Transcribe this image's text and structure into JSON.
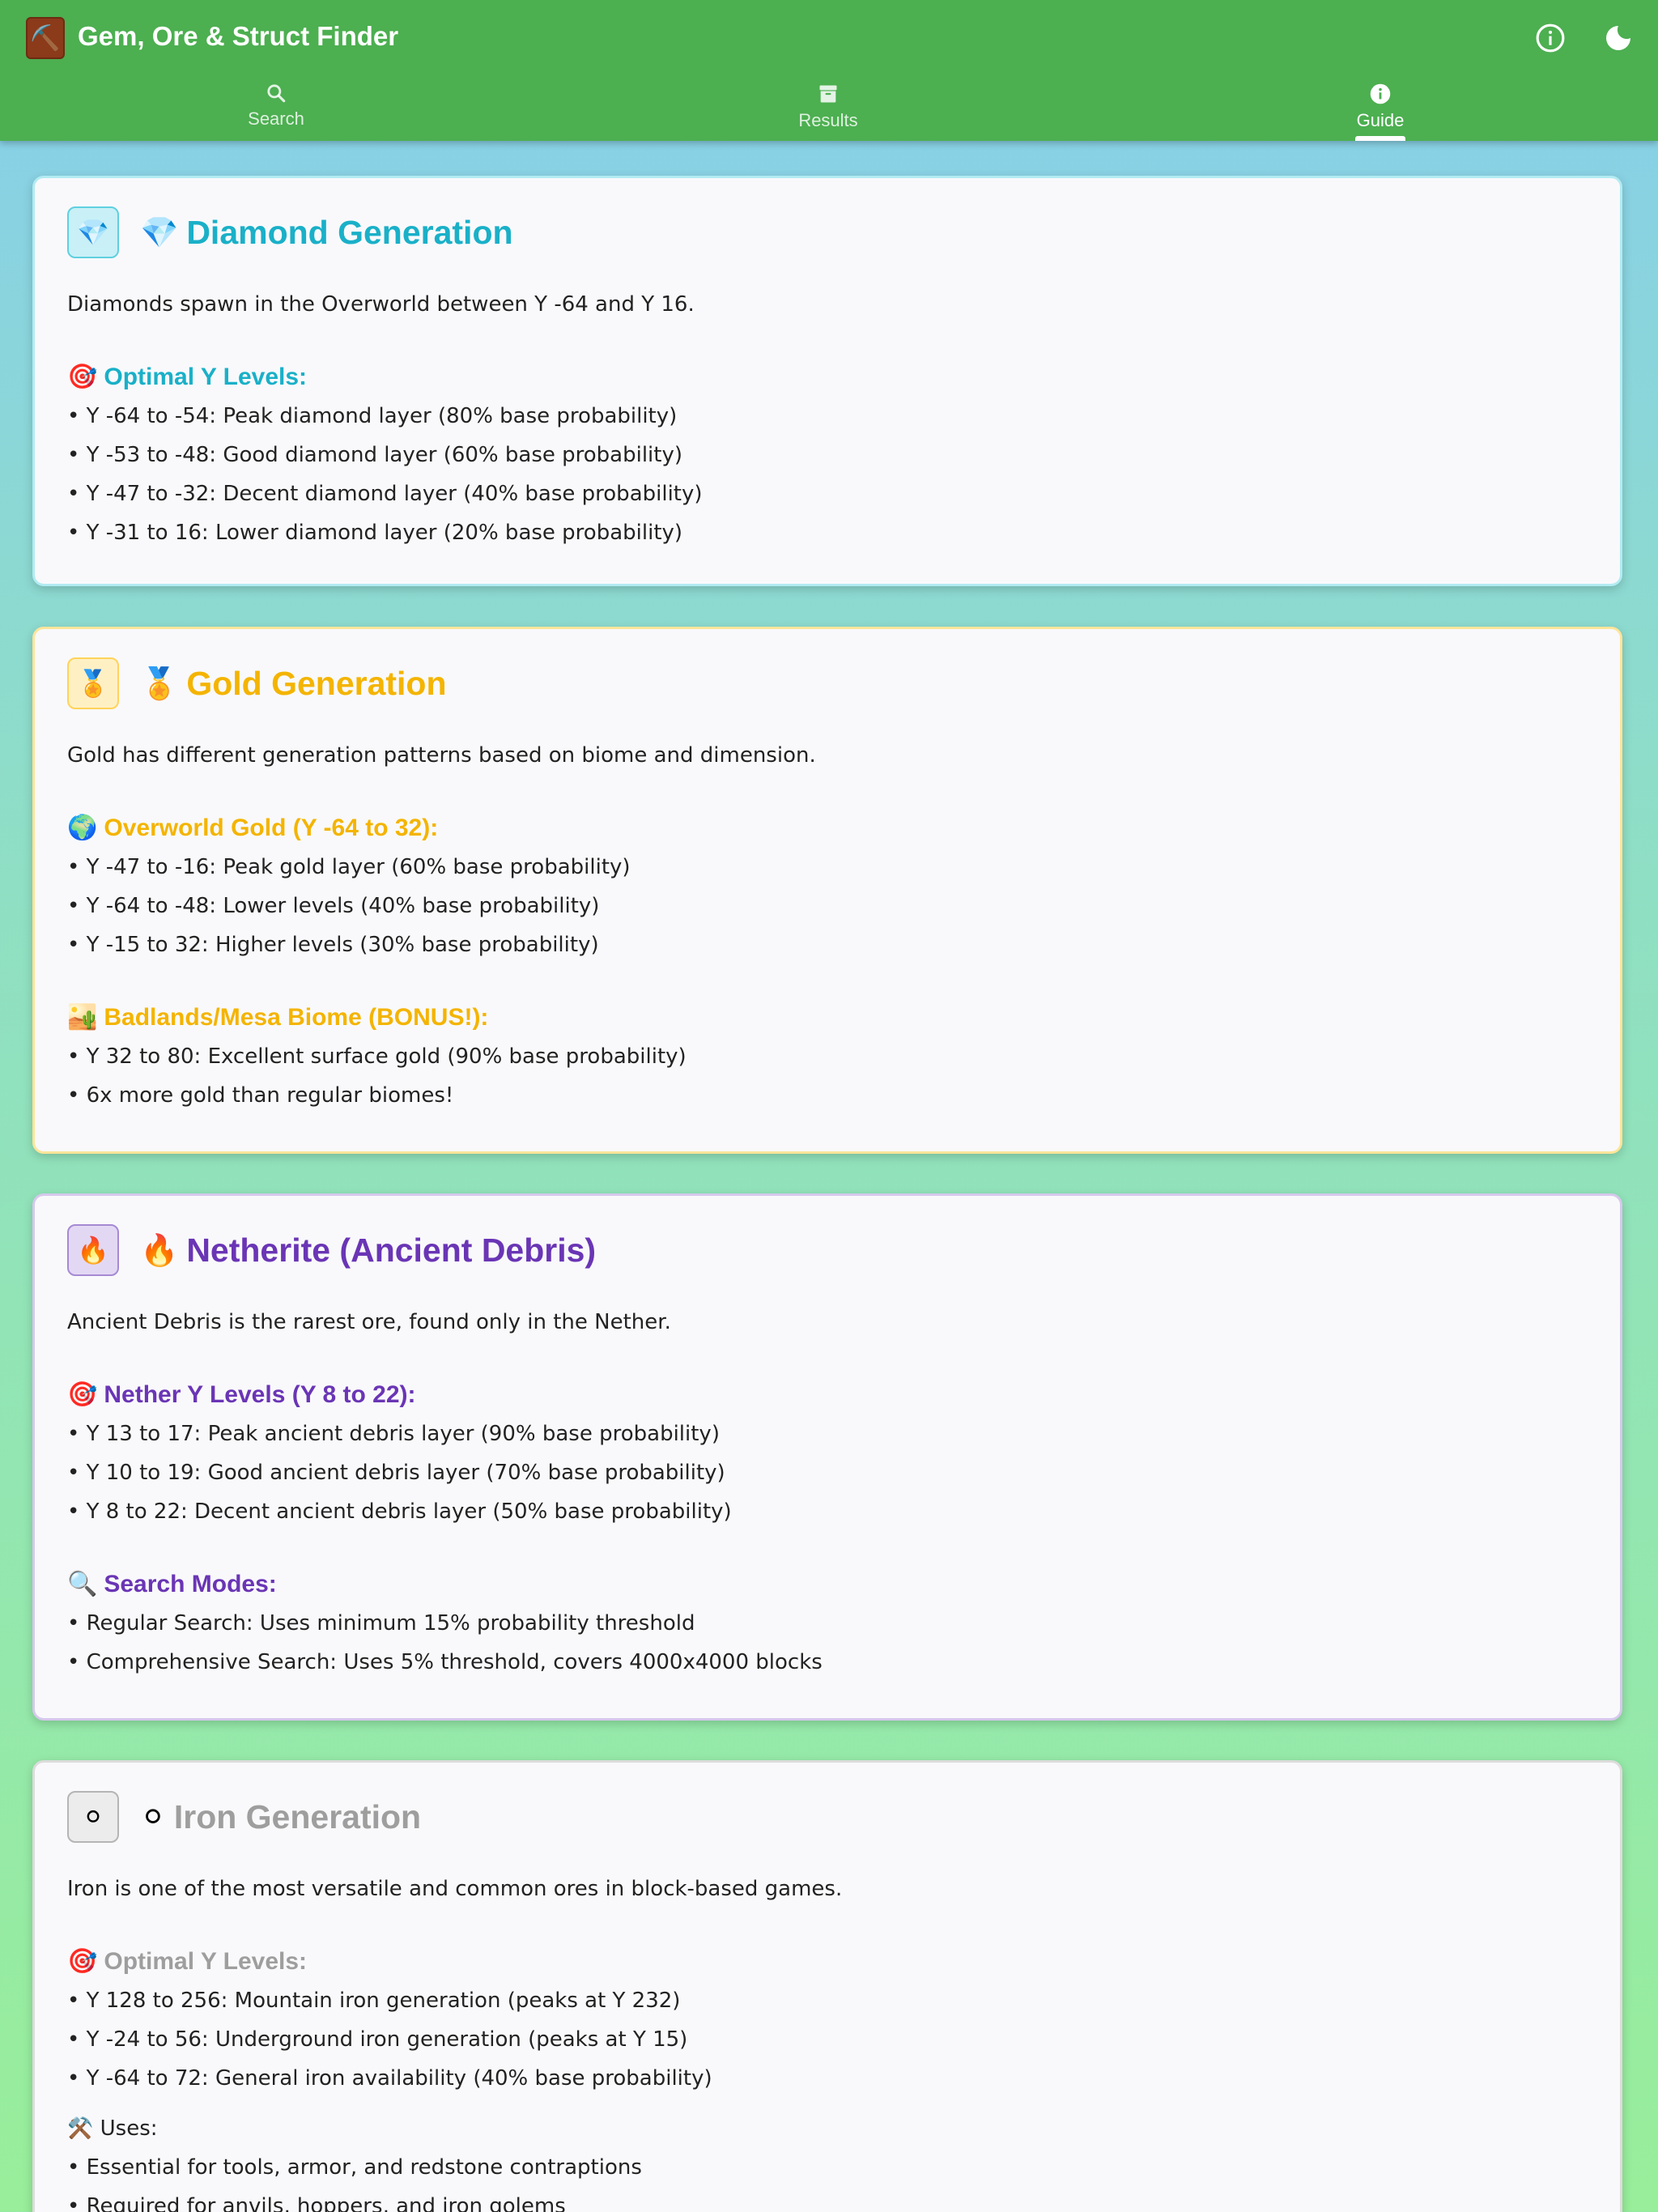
{
  "app": {
    "title": "Gem, Ore & Struct Finder",
    "logo_icon": "⛏️",
    "colors": {
      "appbar": "#4caf50"
    }
  },
  "header_actions": [
    {
      "name": "info-icon"
    },
    {
      "name": "dark-mode-icon"
    }
  ],
  "tabs": [
    {
      "label": "Search",
      "icon": "search-icon",
      "active": false
    },
    {
      "label": "Results",
      "icon": "archive-icon",
      "active": false
    },
    {
      "label": "Guide",
      "icon": "info-icon",
      "active": true
    }
  ],
  "cards": [
    {
      "id": "diamond",
      "badge": "💎",
      "emoji": "💎",
      "title": "Diamond Generation",
      "accent": "#1ab0c8",
      "description": "Diamonds spawn in the Overworld between Y -64 and Y 16.",
      "sections": [
        {
          "emoji": "🎯",
          "heading": "Optimal Y Levels:",
          "items": [
            "• Y -64 to -54: Peak diamond layer (80% base probability)",
            "• Y -53 to -48: Good diamond layer (60% base probability)",
            "• Y -47 to -32: Decent diamond layer (40% base probability)",
            "• Y -31 to 16: Lower diamond layer (20% base probability)"
          ]
        }
      ]
    },
    {
      "id": "gold",
      "badge": "🏅",
      "emoji": "🏅",
      "title": "Gold Generation",
      "accent": "#f4b400",
      "description": "Gold has different generation patterns based on biome and dimension.",
      "sections": [
        {
          "emoji": "🌍",
          "heading": "Overworld Gold (Y -64 to 32):",
          "items": [
            "• Y -47 to -16: Peak gold layer (60% base probability)",
            "• Y -64 to -48: Lower levels (40% base probability)",
            "• Y -15 to 32: Higher levels (30% base probability)"
          ]
        },
        {
          "emoji": "🏜️",
          "heading": "Badlands/Mesa Biome (BONUS!):",
          "items": [
            "• Y 32 to 80: Excellent surface gold (90% base probability)",
            "• 6x more gold than regular biomes!"
          ]
        }
      ]
    },
    {
      "id": "netherite",
      "badge": "🔥",
      "emoji": "🔥",
      "title": "Netherite (Ancient Debris)",
      "accent": "#6a35b5",
      "description": "Ancient Debris is the rarest ore, found only in the Nether.",
      "sections": [
        {
          "emoji": "🎯",
          "heading": "Nether Y Levels (Y 8 to 22):",
          "items": [
            "• Y 13 to 17: Peak ancient debris layer (90% base probability)",
            "• Y 10 to 19: Good ancient debris layer (70% base probability)",
            "• Y 8 to 22: Decent ancient debris layer (50% base probability)"
          ]
        },
        {
          "emoji": "🔍",
          "heading": "Search Modes:",
          "items": [
            "• Regular Search: Uses minimum 15% probability threshold",
            "• Comprehensive Search: Uses 5% threshold, covers 4000x4000 blocks"
          ]
        }
      ]
    },
    {
      "id": "iron",
      "badge": "⚪",
      "emoji": "⚪",
      "title": "Iron Generation",
      "accent": "#9e9e9e",
      "description": "Iron is one of the most versatile and common ores in block-based games.",
      "sections": [
        {
          "emoji": "🎯",
          "heading": "Optimal Y Levels:",
          "items": [
            "• Y 128 to 256: Mountain iron generation (peaks at Y 232)",
            "• Y -24 to 56: Underground iron generation (peaks at Y 15)",
            "• Y -64 to 72: General iron availability (40% base probability)"
          ]
        }
      ],
      "uses": {
        "emoji": "⚒️",
        "heading": "Uses:",
        "items": [
          "• Essential for tools, armor, and redstone contraptions",
          "• Required for anvils, hoppers, and iron golems"
        ]
      }
    }
  ]
}
